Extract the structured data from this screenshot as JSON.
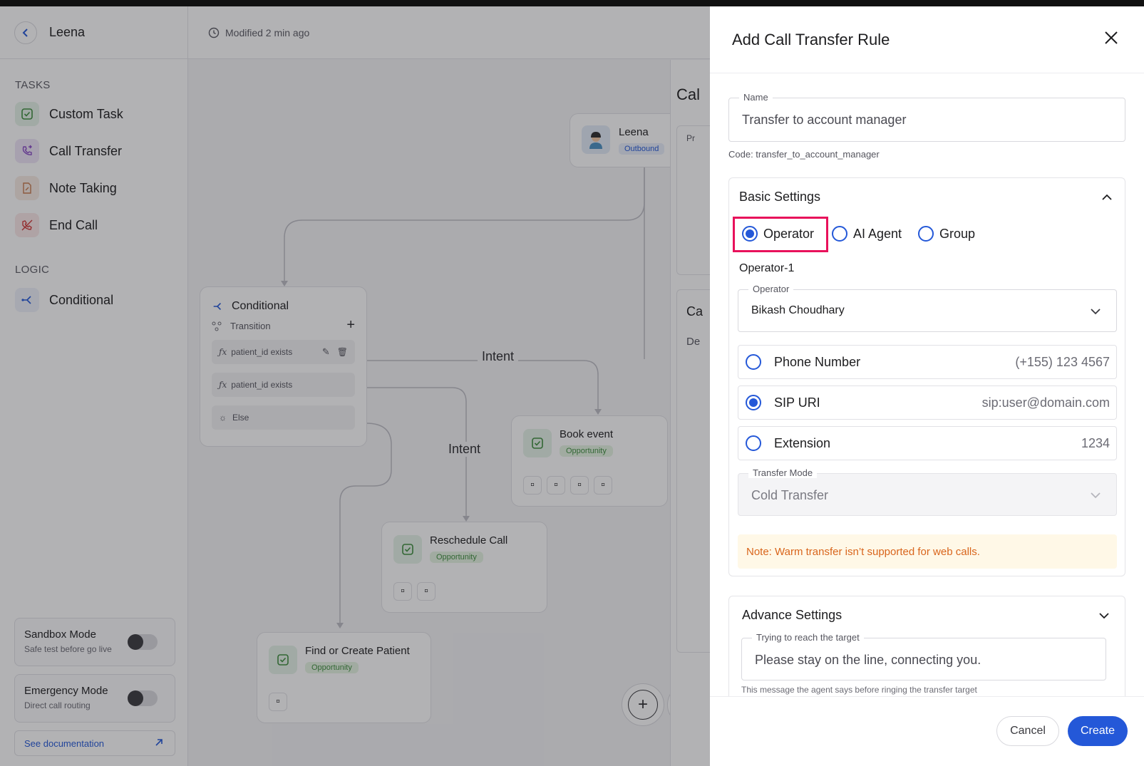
{
  "app": {
    "agent_name": "Leena",
    "modified": "Modified 2 min ago"
  },
  "sidebar": {
    "tasks_heading": "TASKS",
    "tasks": [
      {
        "label": "Custom Task",
        "icon": "checkbox-icon"
      },
      {
        "label": "Call Transfer",
        "icon": "phone-transfer-icon"
      },
      {
        "label": "Note Taking",
        "icon": "note-icon"
      },
      {
        "label": "End Call",
        "icon": "phone-off-icon"
      }
    ],
    "logic_heading": "LOGIC",
    "logic": [
      {
        "label": "Conditional",
        "icon": "branch-icon"
      }
    ],
    "sandbox": {
      "title": "Sandbox Mode",
      "subtitle": "Safe test before go live"
    },
    "emergency": {
      "title": "Emergency Mode",
      "subtitle": "Direct call routing"
    },
    "doc_link": "See documentation"
  },
  "canvas": {
    "agent_node": {
      "name": "Leena",
      "badge": "Outbound"
    },
    "conditional": {
      "title": "Conditional",
      "transition": "Transition",
      "rows": [
        "patient_id exists",
        "patient_id exists",
        "Else"
      ]
    },
    "edge_labels": [
      "Intent",
      "Intent"
    ],
    "nodes": [
      {
        "title": "Book event",
        "badge": "Opportunity"
      },
      {
        "title": "Reschedule Call",
        "badge": "Opportunity"
      },
      {
        "title": "Find or Create Patient",
        "badge": "Opportunity"
      }
    ],
    "right_panel_fragments": [
      "Cal",
      "Pr",
      "Ca",
      "De"
    ]
  },
  "modal": {
    "title": "Add Call Transfer Rule",
    "name_label": "Name",
    "name_value": "Transfer to account manager",
    "code": "Code: transfer_to_account_manager",
    "basic_settings": {
      "title": "Basic Settings",
      "types": [
        "Operator",
        "AI Agent",
        "Group"
      ],
      "selected_type": "Operator",
      "operator_heading": "Operator-1",
      "operator_label": "Operator",
      "operator_value": "Bikash Choudhary",
      "destinations": [
        {
          "label": "Phone Number",
          "value": "(+155) 123 4567",
          "selected": false
        },
        {
          "label": "SIP URI",
          "value": "sip:user@domain.com",
          "selected": true
        },
        {
          "label": "Extension",
          "value": "1234",
          "selected": false
        }
      ],
      "transfer_mode_label": "Transfer Mode",
      "transfer_mode_value": "Cold Transfer",
      "note": "Note: Warm transfer isn’t supported for web calls."
    },
    "advance_settings": {
      "title": "Advance Settings",
      "reach_label": "Trying to reach the target",
      "reach_value": "Please stay on the line, connecting you.",
      "helper": "This message the agent says before ringing the transfer target"
    },
    "cancel": "Cancel",
    "create": "Create"
  },
  "colors": {
    "accent": "#2458d8",
    "highlight": "#e8115b",
    "note_text": "#d9651c"
  }
}
